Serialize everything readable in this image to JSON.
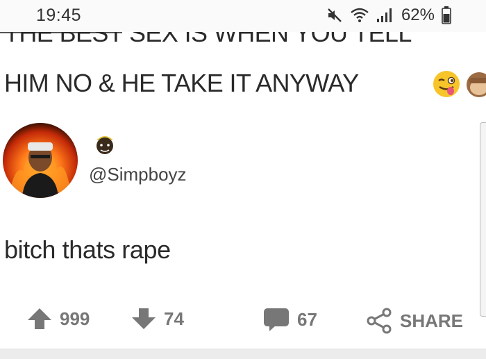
{
  "status_bar": {
    "time": "19:45",
    "battery": "62%",
    "icons": [
      "mute-icon",
      "wifi-icon",
      "signal-icon",
      "battery-icon"
    ]
  },
  "post": {
    "headline_line1": "THE BEST SEX IS WHEN YOU TELL",
    "headline_line2": "HIM NO & HE TAKE IT ANYWAY",
    "emojis": [
      "winking-tongue-emoji",
      "see-no-evil-monkey-emoji"
    ],
    "reply": {
      "handle": "@Simpboyz",
      "text": "bitch thats rape"
    }
  },
  "actions": {
    "upvotes": "999",
    "downvotes": "74",
    "comments": "67",
    "share_label": "SHARE"
  },
  "colors": {
    "action_gray": "#777777",
    "text": "#2a2a2a"
  }
}
